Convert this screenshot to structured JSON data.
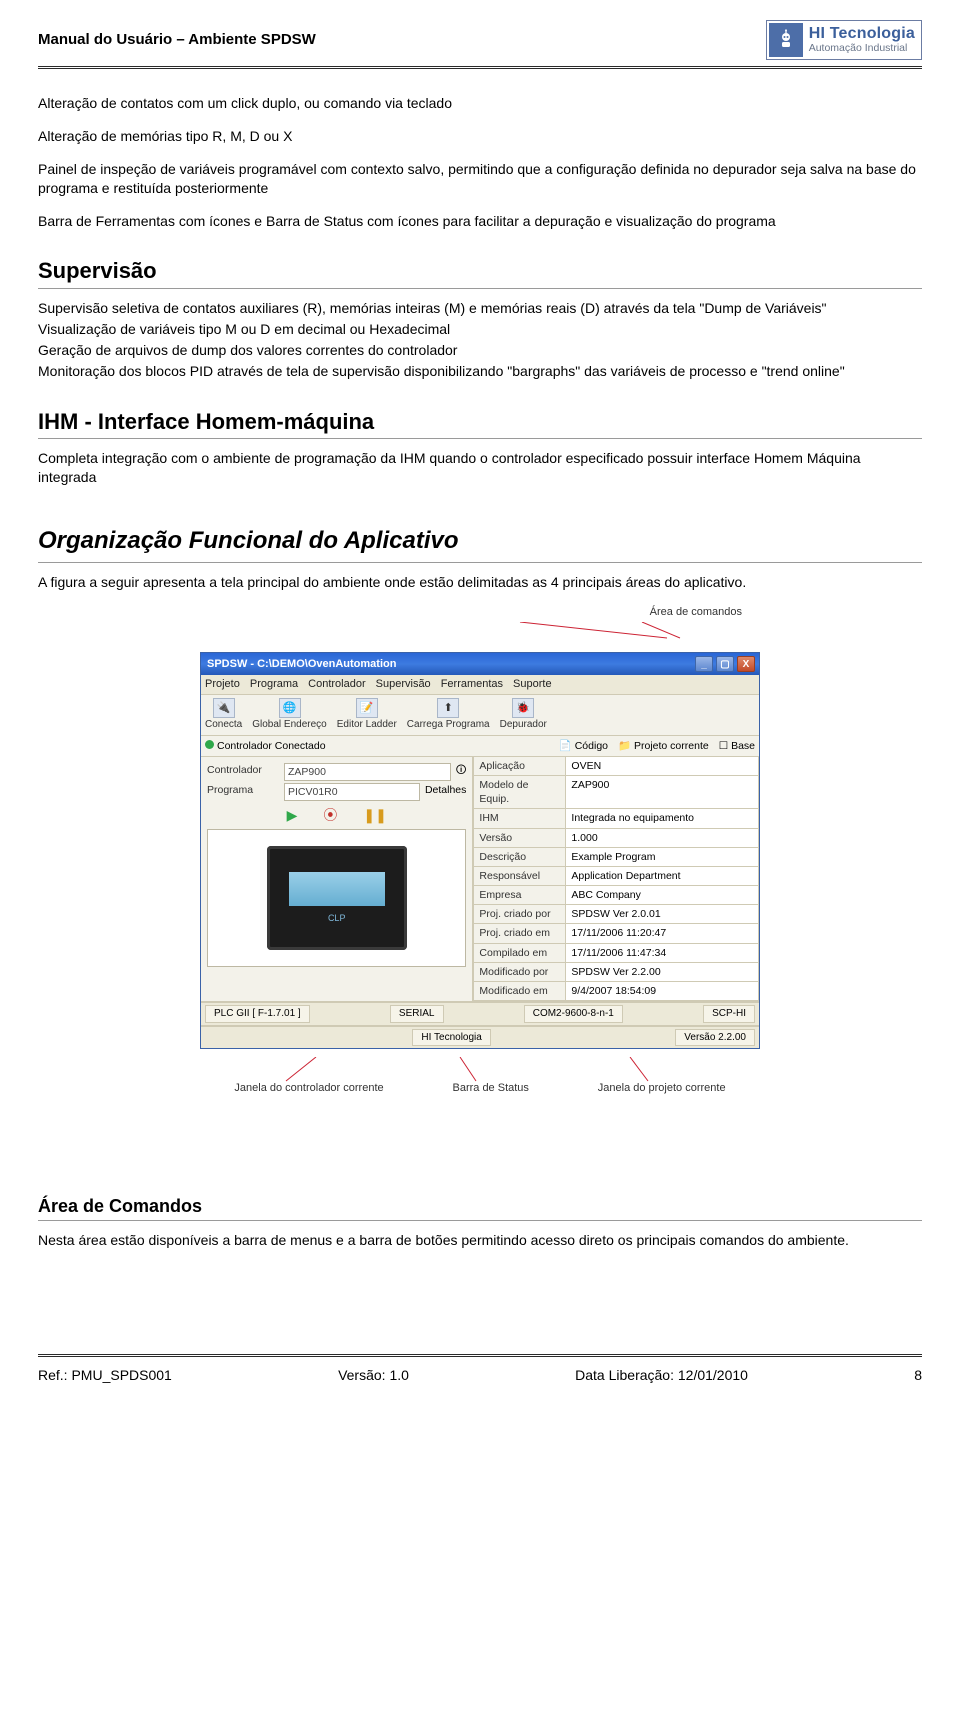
{
  "header": {
    "title": "Manual do Usuário – Ambiente SPDSW",
    "brand": "HI Tecnologia",
    "brandSub": "Automação Industrial"
  },
  "intro": {
    "p1": "Alteração de contatos com um click duplo, ou comando via teclado",
    "p2": "Alteração de memórias tipo R, M, D ou X",
    "p3": "Painel de inspeção de variáveis programável com contexto salvo, permitindo que a configuração definida no depurador seja salva na base do programa e restituída posteriormente",
    "p4": "Barra de Ferramentas com ícones e Barra de Status com ícones para facilitar a depuração e visualização do programa"
  },
  "supervisao": {
    "title": "Supervisão",
    "p1": "Supervisão seletiva de contatos auxiliares (R), memórias inteiras (M) e memórias reais (D) através da tela \"Dump de Variáveis\"",
    "p2": "Visualização de variáveis tipo M ou D em decimal ou Hexadecimal",
    "p3": "Geração de arquivos de dump dos valores correntes do controlador",
    "p4": "Monitoração dos blocos PID através de tela de supervisão disponibilizando \"bargraphs\" das variáveis de processo e \"trend online\""
  },
  "ihm": {
    "title": "IHM - Interface Homem-máquina",
    "p1": "Completa integração com o ambiente de programação da IHM quando o controlador especificado possuir interface Homem Máquina integrada"
  },
  "org": {
    "title": "Organização Funcional do Aplicativo",
    "p1": "A figura a seguir apresenta a tela principal do ambiente onde estão delimitadas as 4 principais áreas do aplicativo."
  },
  "callouts": {
    "top": "Área de comandos",
    "bottom1": "Janela do controlador corrente",
    "bottom2": "Barra de Status",
    "bottom3": "Janela do projeto corrente"
  },
  "app": {
    "winTitle": "SPDSW - C:\\DEMO\\OvenAutomation",
    "menu": [
      "Projeto",
      "Programa",
      "Controlador",
      "Supervisão",
      "Ferramentas",
      "Suporte"
    ],
    "toolbar": [
      {
        "icon": "🔌",
        "label": "Conecta"
      },
      {
        "icon": "🌐",
        "label": "Global Endereço"
      },
      {
        "icon": "📝",
        "label": "Editor Ladder"
      },
      {
        "icon": "⬆",
        "label": "Carrega Programa"
      },
      {
        "icon": "🐞",
        "label": "Depurador"
      }
    ],
    "status1": {
      "state": "Controlador Conectado",
      "codigo": "Código",
      "proj": "Projeto corrente",
      "base": "Base"
    },
    "left": {
      "controladorKey": "Controlador",
      "controladorVal": "ZAP900",
      "programaKey": "Programa",
      "programaVal": "PICV01R0",
      "detalhes": "Detalhes",
      "plc": "PLC  GII [ F-1.7.01 ]"
    },
    "details": [
      {
        "k": "Aplicação",
        "v": "OVEN"
      },
      {
        "k": "Modelo de Equip.",
        "v": "ZAP900"
      },
      {
        "k": "IHM",
        "v": "Integrada no equipamento"
      },
      {
        "k": "Versão",
        "v": "1.000"
      },
      {
        "k": "Descrição",
        "v": "Example Program"
      },
      {
        "k": "Responsável",
        "v": "Application Department"
      },
      {
        "k": "Empresa",
        "v": "ABC Company"
      },
      {
        "k": "Proj. criado por",
        "v": "SPDSW Ver 2.0.01"
      },
      {
        "k": "Proj. criado em",
        "v": "17/11/2006 11:20:47"
      },
      {
        "k": "Compilado em",
        "v": "17/11/2006 11:47:34"
      },
      {
        "k": "Modificado por",
        "v": "SPDSW Ver 2.2.00"
      },
      {
        "k": "Modificado em",
        "v": "9/4/2007 18:54:09"
      }
    ],
    "foot": {
      "serial": "SERIAL",
      "com": "COM2-9600-8-n-1",
      "scp": "SCP-HI",
      "hi": "HI Tecnologia",
      "ver": "Versão 2.2.00"
    }
  },
  "comandos": {
    "title": "Área de Comandos",
    "p1": "Nesta área estão disponíveis a barra de menus e a barra de botões permitindo acesso direto os principais comandos do ambiente."
  },
  "footer": {
    "ref": "Ref.: PMU_SPDS001",
    "versao": "Versão: 1.0",
    "data": "Data Liberação: 12/01/2010",
    "page": "8"
  }
}
